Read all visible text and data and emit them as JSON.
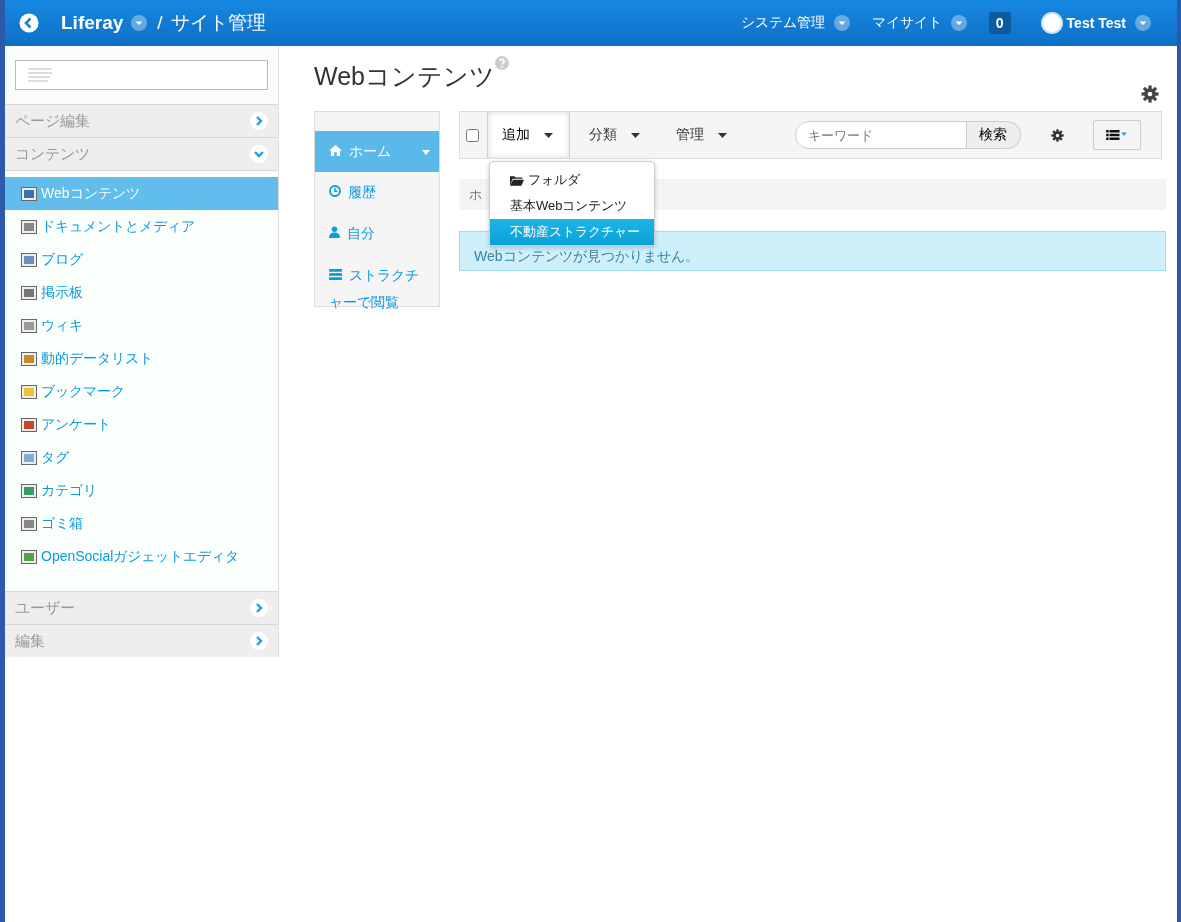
{
  "header": {
    "site": "Liferay",
    "separator": "/",
    "title": "サイト管理",
    "menus": [
      {
        "label": "システム管理"
      },
      {
        "label": "マイサイト"
      }
    ],
    "notifications": "0",
    "user": "Test Test"
  },
  "sidebar": {
    "sections": [
      {
        "title": "ページ編集",
        "expanded": false
      },
      {
        "title": "コンテンツ",
        "expanded": true,
        "items": [
          {
            "label": "Webコンテンツ",
            "selected": true
          },
          {
            "label": "ドキュメントとメディア",
            "selected": false
          },
          {
            "label": "ブログ",
            "selected": false
          },
          {
            "label": "掲示板",
            "selected": false
          },
          {
            "label": "ウィキ",
            "selected": false
          },
          {
            "label": "動的データリスト",
            "selected": false
          },
          {
            "label": "ブックマーク",
            "selected": false
          },
          {
            "label": "アンケート",
            "selected": false
          },
          {
            "label": "タグ",
            "selected": false
          },
          {
            "label": "カテゴリ",
            "selected": false
          },
          {
            "label": "ゴミ箱",
            "selected": false
          },
          {
            "label": "OpenSocialガジェットエディタ",
            "selected": false
          }
        ]
      },
      {
        "title": "ユーザー",
        "expanded": false
      },
      {
        "title": "編集",
        "expanded": false
      }
    ]
  },
  "page": {
    "title": "Webコンテンツ"
  },
  "nav": [
    {
      "label": "ホーム",
      "kind": "home",
      "selected": true
    },
    {
      "label": "履歴",
      "kind": "recent",
      "selected": false
    },
    {
      "label": "自分",
      "kind": "mine",
      "selected": false
    },
    {
      "label": "ストラクチャーで閲覧",
      "kind": "structure",
      "selected": false
    }
  ],
  "toolbar": {
    "select_all": {
      "checked": false
    },
    "menus": [
      {
        "label": "追加",
        "open": true
      },
      {
        "label": "分類",
        "open": false
      },
      {
        "label": "管理",
        "open": false
      }
    ],
    "search": {
      "placeholder": "キーワード",
      "button": "検索"
    }
  },
  "add_menu": [
    {
      "label": "フォルダ",
      "kind": "folder",
      "selected": false
    },
    {
      "label": "基本Webコンテンツ",
      "kind": "plain",
      "selected": false
    },
    {
      "label": "不動産ストラクチャー",
      "kind": "plain",
      "selected": true
    }
  ],
  "breadcrumb": "ホ",
  "alert": "Webコンテンツが見つかりません。"
}
